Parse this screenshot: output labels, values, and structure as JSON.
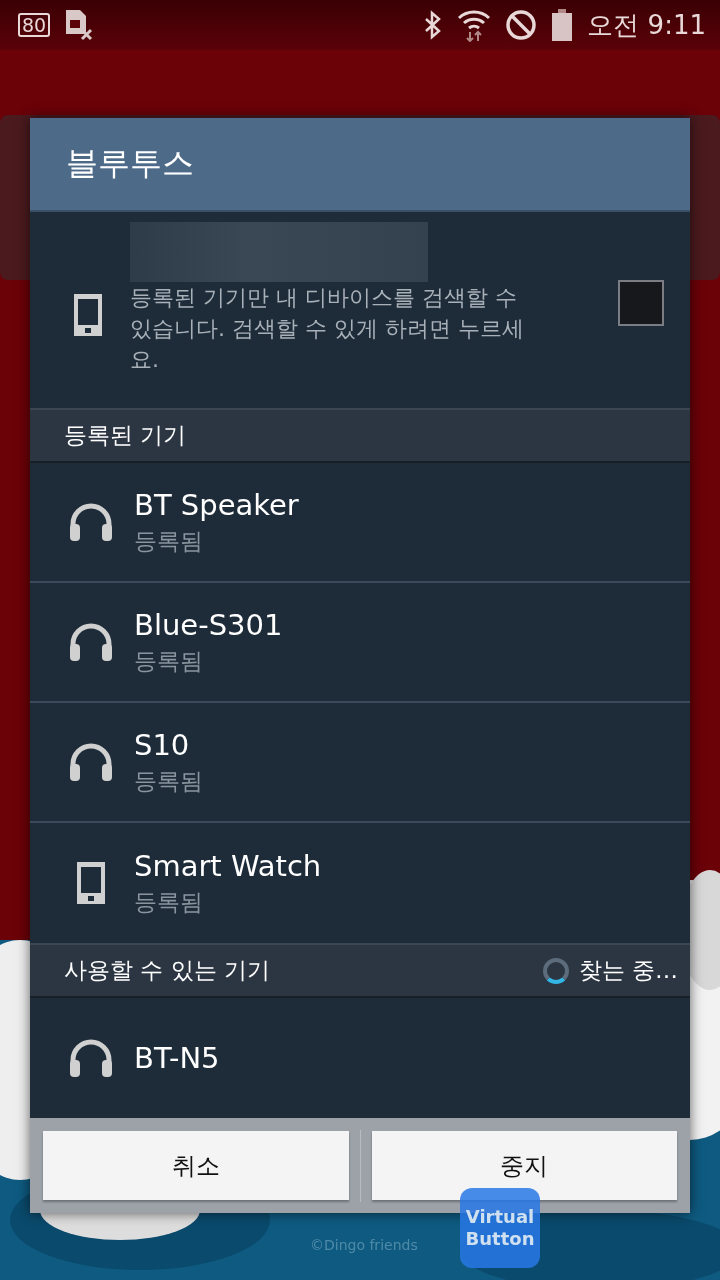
{
  "status_bar": {
    "battery_badge": "80",
    "time": "오전 9:11"
  },
  "dialog": {
    "title": "블루투스",
    "visibility": {
      "hint": "등록된 기기만 내 디바이스를 검색할 수 있습니다. 검색할 수 있게 하려면 누르세요.",
      "checked": false
    },
    "sections": [
      {
        "title": "등록된 기기",
        "searching": false,
        "devices": [
          {
            "name": "BT Speaker",
            "status": "등록됨",
            "kind": "headset"
          },
          {
            "name": "Blue-S301",
            "status": "등록됨",
            "kind": "headset"
          },
          {
            "name": "S10",
            "status": "등록됨",
            "kind": "headset"
          },
          {
            "name": "Smart Watch",
            "status": "등록됨",
            "kind": "phone"
          }
        ]
      },
      {
        "title": "사용할 수 있는 기기",
        "searching": true,
        "search_label": "찾는 중…",
        "devices": [
          {
            "name": "BT-N5",
            "kind": "headset"
          }
        ]
      }
    ],
    "buttons": [
      "취소",
      "중지"
    ]
  },
  "wallpaper": {
    "credit": "©Dingo friends"
  },
  "floating_button": {
    "label": "Virtual Button"
  }
}
